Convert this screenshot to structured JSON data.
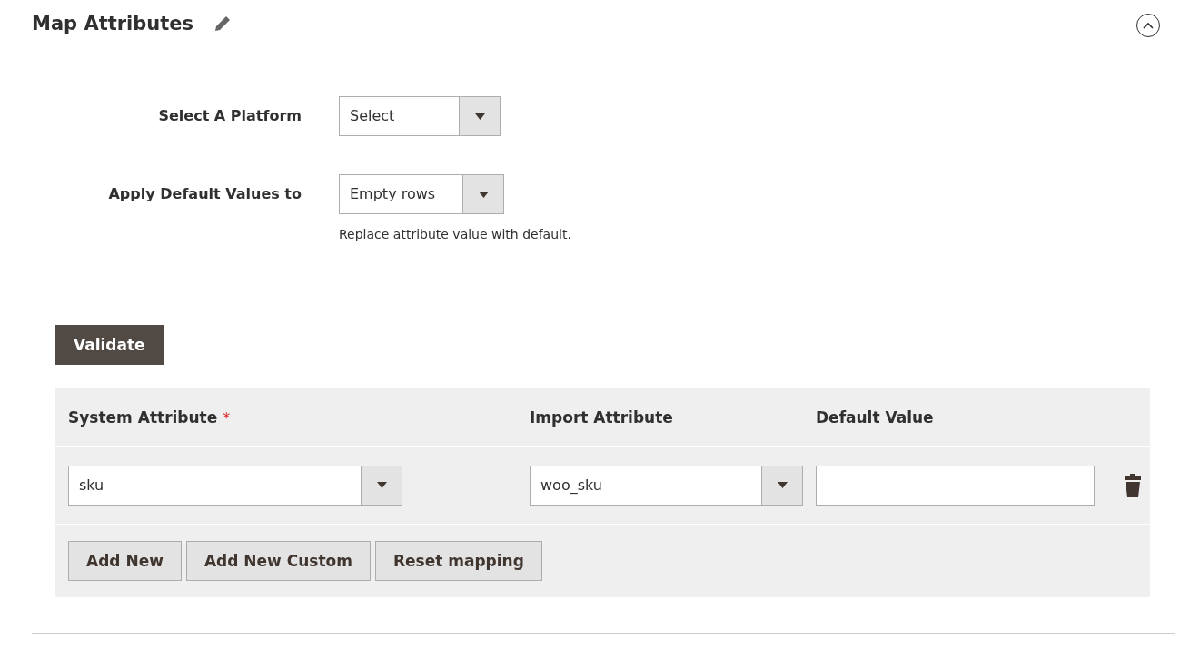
{
  "section": {
    "title": "Map Attributes",
    "expanded": true
  },
  "form": [
    {
      "label": "Select A Platform",
      "value": "Select"
    },
    {
      "label": "Apply Default Values to",
      "value": "Empty rows",
      "note": "Replace attribute value with default."
    }
  ],
  "validate_button": "Validate",
  "table": {
    "columns": [
      {
        "label": "System Attribute",
        "required_mark": "*"
      },
      {
        "label": "Import Attribute"
      },
      {
        "label": "Default Value"
      }
    ],
    "rows": [
      {
        "system_attribute": "sku",
        "import_attribute": "woo_sku"
      }
    ],
    "buttons": [
      "Add New",
      "Add New Custom",
      "Reset mapping"
    ]
  }
}
